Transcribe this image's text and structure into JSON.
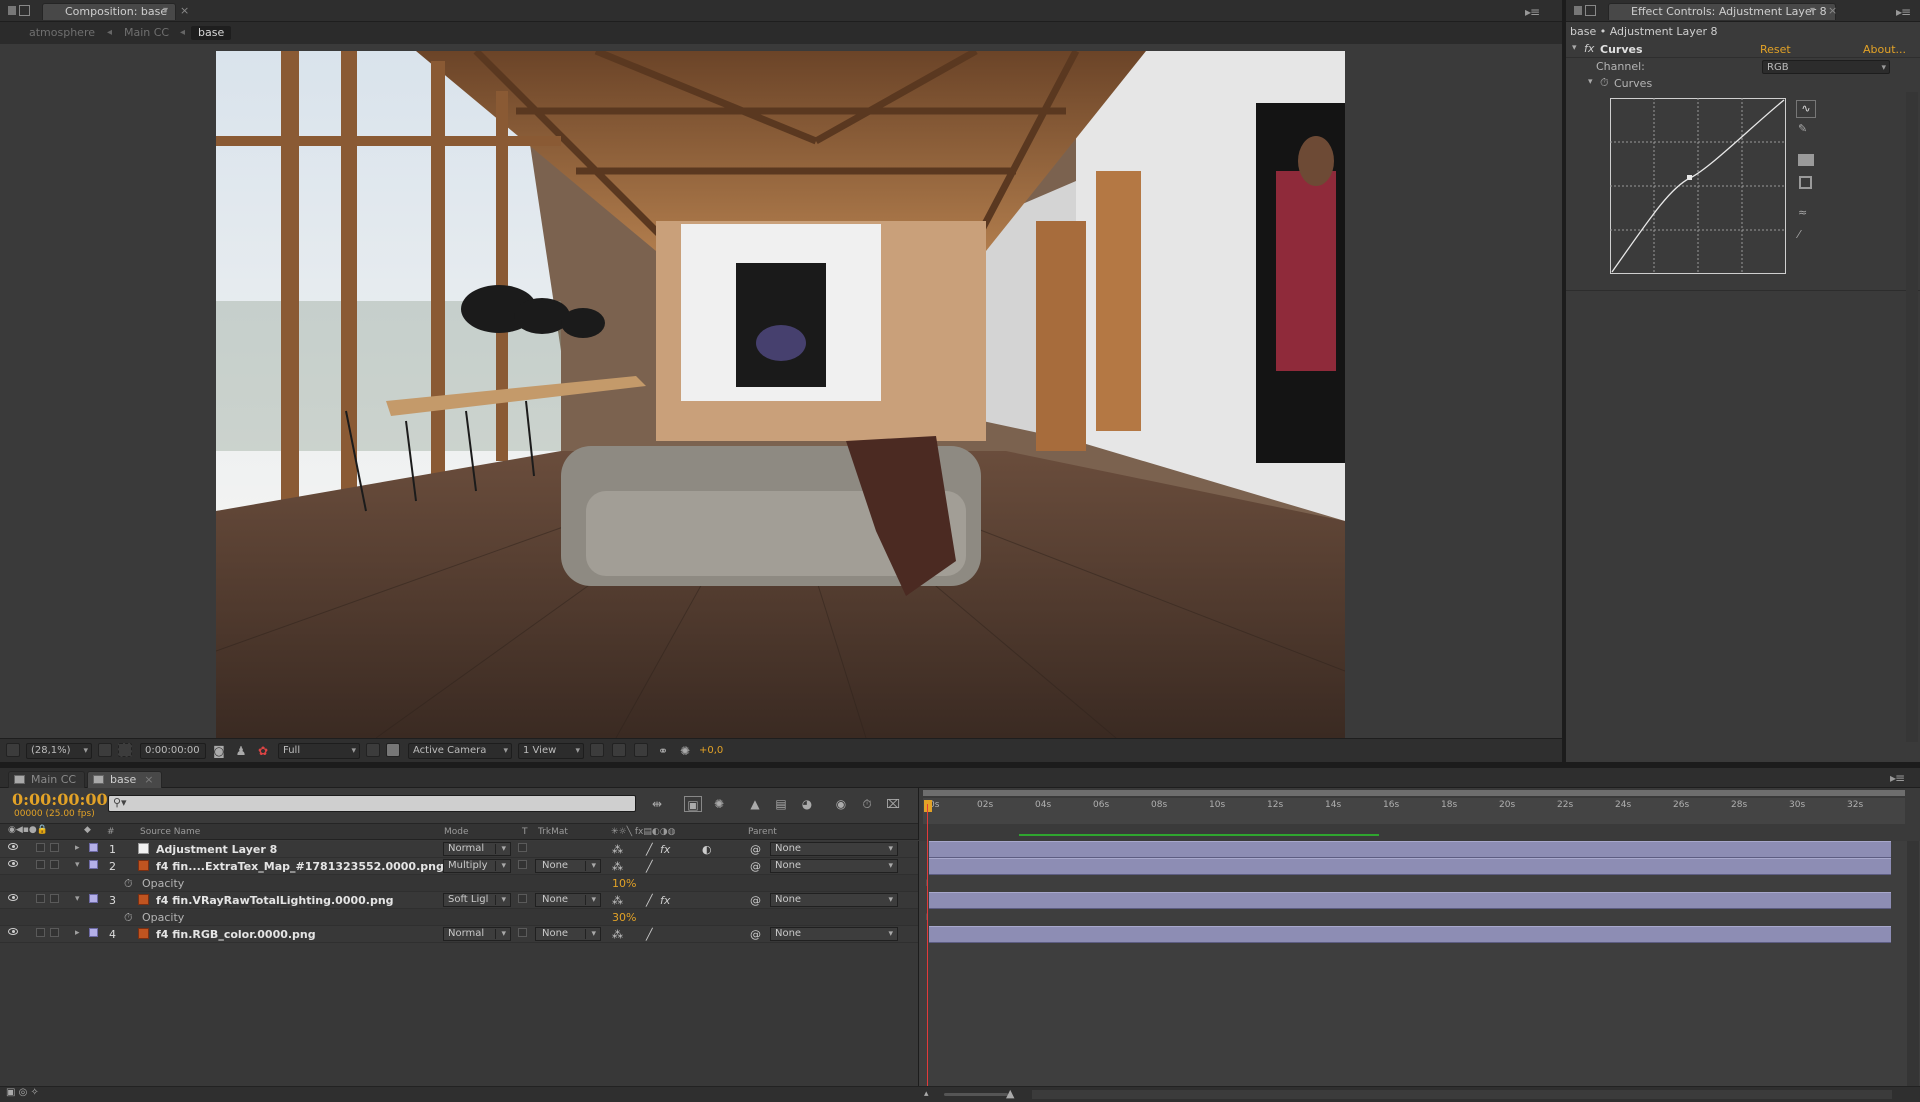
{
  "composition_panel": {
    "tab_title": "Composition: base",
    "subtabs": [
      "atmosphere",
      "Main CC",
      "base"
    ],
    "footer": {
      "zoom": "(28,1%)",
      "timecode": "0:00:00:00",
      "resolution": "Full",
      "camera": "Active Camera",
      "view": "1 View",
      "exposure": "+0,0"
    }
  },
  "effect_controls": {
    "tab_title": "Effect Controls: Adjustment Layer 8",
    "breadcrumb": "base • Adjustment Layer 8",
    "effect_name": "Curves",
    "reset_label": "Reset",
    "about_label": "About...",
    "channel_label": "Channel:",
    "channel_value": "RGB",
    "curves_label": "Curves"
  },
  "timeline": {
    "tabs": [
      "Main CC",
      "base"
    ],
    "timecode": "0:00:00:00",
    "frame_info": "00000 (25.00 fps)",
    "columns": {
      "source_name": "Source Name",
      "mode": "Mode",
      "t": "T",
      "trkmat": "TrkMat",
      "parent": "Parent",
      "number": "#"
    },
    "ruler_ticks": [
      "0s",
      "02s",
      "04s",
      "06s",
      "08s",
      "10s",
      "12s",
      "14s",
      "16s",
      "18s",
      "20s",
      "22s",
      "24s",
      "26s",
      "28s",
      "30s",
      "32s"
    ],
    "layers": [
      {
        "num": "1",
        "name": "Adjustment Layer 8",
        "mode": "Normal",
        "trkmat": "",
        "parent": "None"
      },
      {
        "num": "2",
        "name": "f4 fin....ExtraTex_Map_#17813235​52.0000.png",
        "mode": "Multiply",
        "trkmat": "None",
        "parent": "None",
        "prop": "Opacity",
        "prop_value": "10%"
      },
      {
        "num": "3",
        "name": "f4 fin.VRayRawTotalLighting.0000.png",
        "mode": "Soft Ligl",
        "trkmat": "None",
        "parent": "None",
        "prop": "Opacity",
        "prop_value": "30%"
      },
      {
        "num": "4",
        "name": "f4 fin.RGB_color.0000.png",
        "mode": "Normal",
        "trkmat": "None",
        "parent": "None"
      }
    ]
  }
}
